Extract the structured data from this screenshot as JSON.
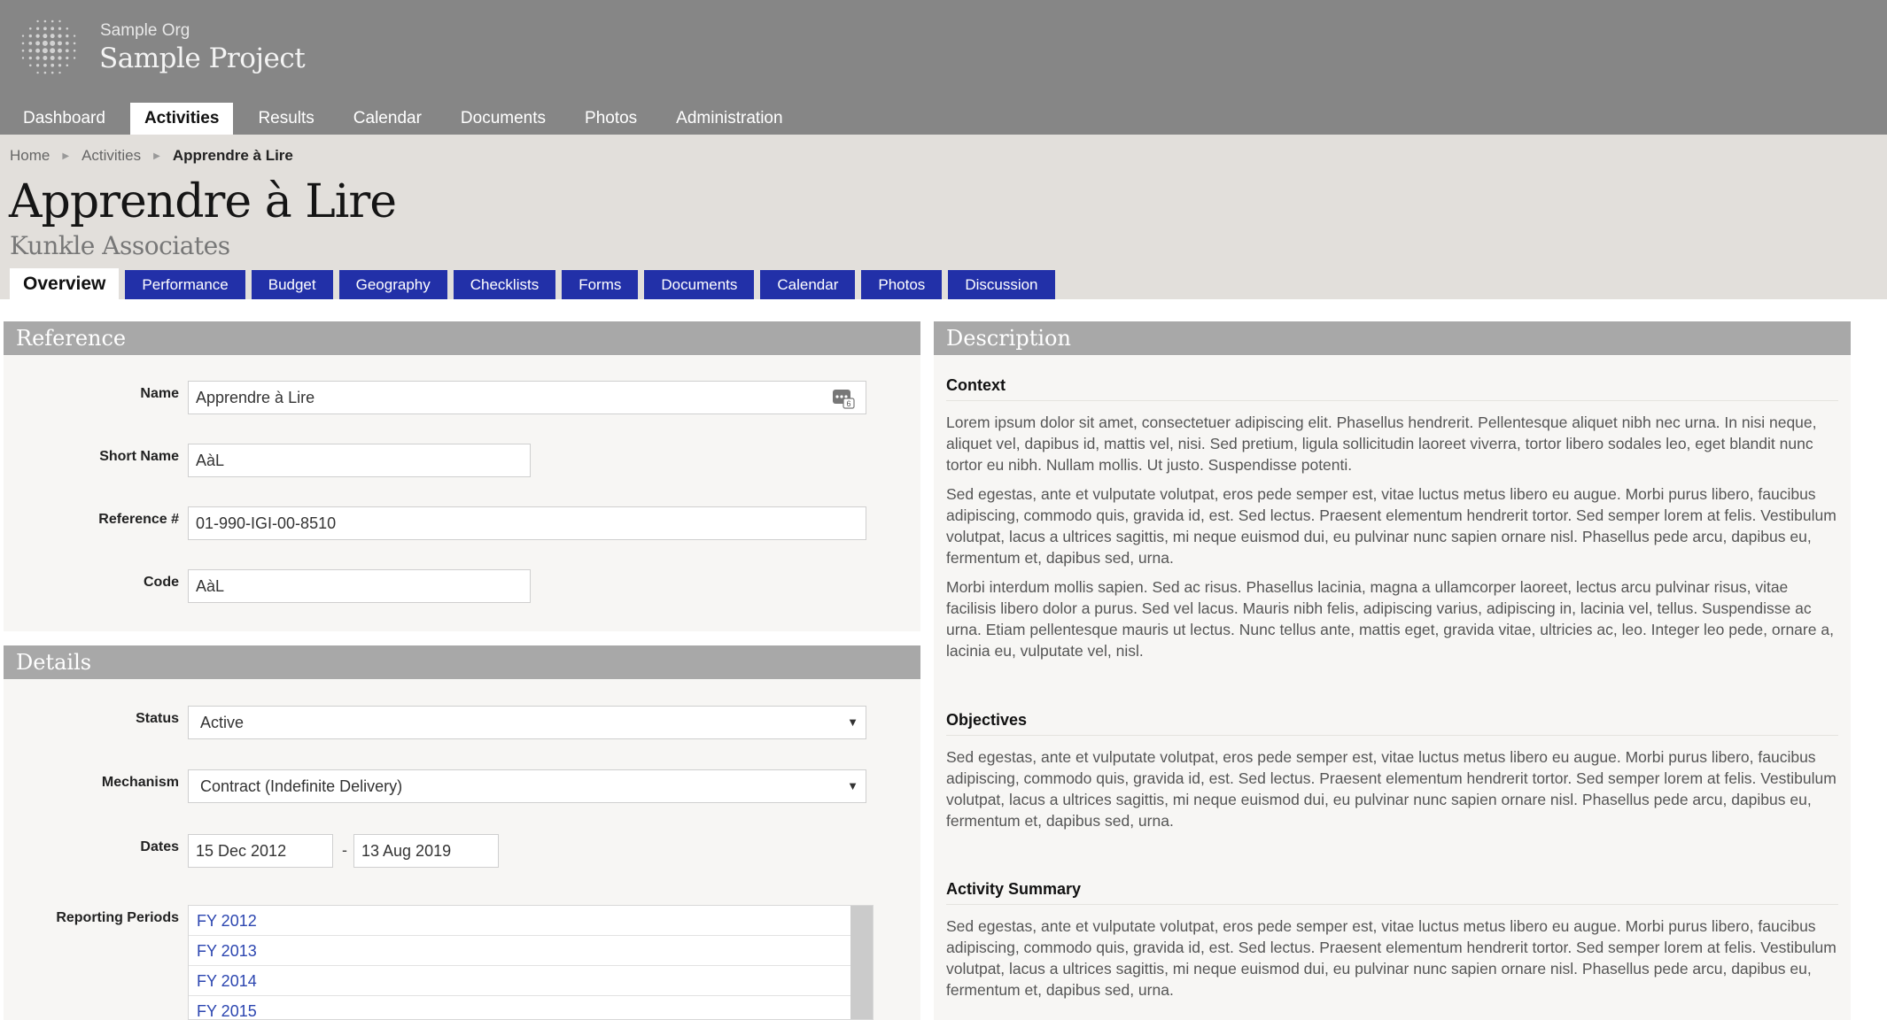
{
  "header": {
    "org": "Sample Org",
    "project": "Sample Project",
    "nav": [
      "Dashboard",
      "Activities",
      "Results",
      "Calendar",
      "Documents",
      "Photos",
      "Administration"
    ],
    "active_nav": "Activities"
  },
  "breadcrumb": {
    "items": [
      "Home",
      "Activities"
    ],
    "current": "Apprendre à Lire"
  },
  "title": "Apprendre à Lire",
  "subtitle": "Kunkle Associates",
  "tabs": [
    "Overview",
    "Performance",
    "Budget",
    "Geography",
    "Checklists",
    "Forms",
    "Documents",
    "Calendar",
    "Photos",
    "Discussion"
  ],
  "active_tab": "Overview",
  "reference": {
    "title": "Reference",
    "name_label": "Name",
    "name_value": "Apprendre à Lire",
    "name_icon": "translation-badge-icon",
    "name_icon_badge": "6",
    "short_name_label": "Short Name",
    "short_name_value": "AàL",
    "ref_label": "Reference #",
    "ref_value": "01-990-IGI-00-8510",
    "code_label": "Code",
    "code_value": "AàL"
  },
  "details": {
    "title": "Details",
    "status_label": "Status",
    "status_value": "Active",
    "mechanism_label": "Mechanism",
    "mechanism_value": "Contract (Indefinite Delivery)",
    "dates_label": "Dates",
    "start_date": "15 Dec 2012",
    "date_sep": "-",
    "end_date": "13 Aug 2019",
    "periods_label": "Reporting Periods",
    "periods": [
      "FY 2012",
      "FY 2013",
      "FY 2014",
      "FY 2015"
    ]
  },
  "description": {
    "title": "Description",
    "context_heading": "Context",
    "context_paras": [
      "Lorem ipsum dolor sit amet, consectetuer adipiscing elit. Phasellus hendrerit. Pellentesque aliquet nibh nec urna. In nisi neque, aliquet vel, dapibus id, mattis vel, nisi. Sed pretium, ligula sollicitudin laoreet viverra, tortor libero sodales leo, eget blandit nunc tortor eu nibh. Nullam mollis. Ut justo. Suspendisse potenti.",
      "Sed egestas, ante et vulputate volutpat, eros pede semper est, vitae luctus metus libero eu augue. Morbi purus libero, faucibus adipiscing, commodo quis, gravida id, est. Sed lectus. Praesent elementum hendrerit tortor. Sed semper lorem at felis. Vestibulum volutpat, lacus a ultrices sagittis, mi neque euismod dui, eu pulvinar nunc sapien ornare nisl. Phasellus pede arcu, dapibus eu, fermentum et, dapibus sed, urna.",
      "Morbi interdum mollis sapien. Sed ac risus. Phasellus lacinia, magna a ullamcorper laoreet, lectus arcu pulvinar risus, vitae facilisis libero dolor a purus. Sed vel lacus. Mauris nibh felis, adipiscing varius, adipiscing in, lacinia vel, tellus. Suspendisse ac urna. Etiam pellentesque mauris ut lectus. Nunc tellus ante, mattis eget, gravida vitae, ultricies ac, leo. Integer leo pede, ornare a, lacinia eu, vulputate vel, nisl."
    ],
    "objectives_heading": "Objectives",
    "objectives_para": "Sed egestas, ante et vulputate volutpat, eros pede semper est, vitae luctus metus libero eu augue. Morbi purus libero, faucibus adipiscing, commodo quis, gravida id, est. Sed lectus. Praesent elementum hendrerit tortor. Sed semper lorem at felis. Vestibulum volutpat, lacus a ultrices sagittis, mi neque euismod dui, eu pulvinar nunc sapien ornare nisl. Phasellus pede arcu, dapibus eu, fermentum et, dapibus sed, urna.",
    "summary_heading": "Activity Summary",
    "summary_para": "Sed egestas, ante et vulputate volutpat, eros pede semper est, vitae luctus metus libero eu augue. Morbi purus libero, faucibus adipiscing, commodo quis, gravida id, est. Sed lectus. Praesent elementum hendrerit tortor. Sed semper lorem at felis. Vestibulum volutpat, lacus a ultrices sagittis, mi neque euismod dui, eu pulvinar nunc sapien ornare nisl. Phasellus pede arcu, dapibus eu, fermentum et, dapibus sed, urna."
  },
  "colors": {
    "header_bg": "#868686",
    "title_band_bg": "#e2dfdb",
    "tab_blue": "#2230a8",
    "panel_header": "#a8a8a8",
    "link_blue": "#2b45b0"
  }
}
